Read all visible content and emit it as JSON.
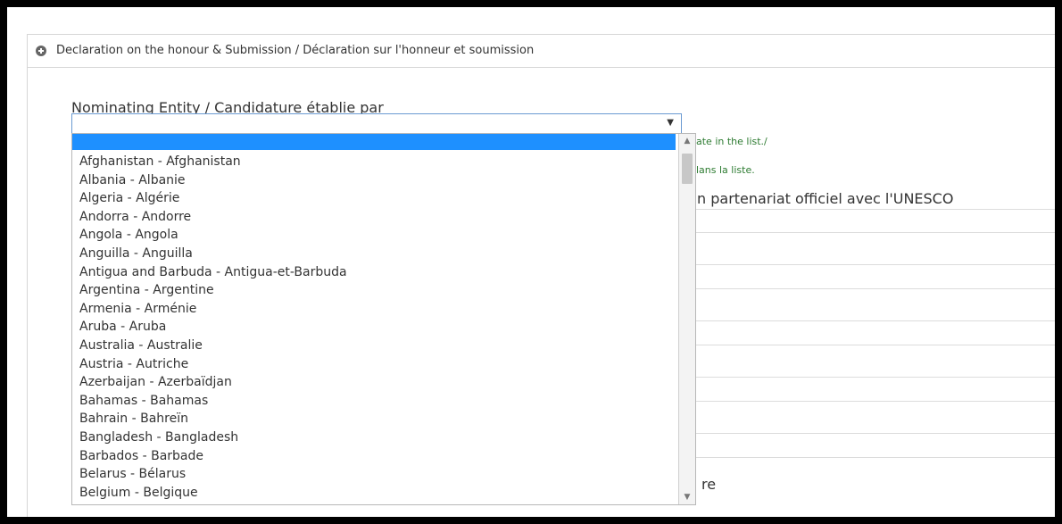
{
  "panel": {
    "title": "Declaration on the honour & Submission / Déclaration sur l'honneur et soumission",
    "icon": "plus-circle-icon"
  },
  "field": {
    "label": "Nominating Entity / Candidature établie par",
    "selected_value": "",
    "arrow": "▼"
  },
  "background": {
    "note_1": "ate in the list./",
    "note_2": "lans la liste.",
    "partnership_label": "n partenariat officiel avec l'UNESCO",
    "partial_label": "re"
  },
  "dropdown": {
    "options": [
      "Afghanistan - Afghanistan",
      "Albania - Albanie",
      "Algeria - Algérie",
      "Andorra - Andorre",
      "Angola - Angola",
      "Anguilla - Anguilla",
      "Antigua and Barbuda - Antigua-et-Barbuda",
      "Argentina - Argentine",
      "Armenia - Arménie",
      "Aruba - Aruba",
      "Australia - Australie",
      "Austria - Autriche",
      "Azerbaijan - Azerbaïdjan",
      "Bahamas - Bahamas",
      "Bahrain - Bahreïn",
      "Bangladesh - Bangladesh",
      "Barbados - Barbade",
      "Belarus - Bélarus",
      "Belgium - Belgique"
    ],
    "scroll_up": "▲",
    "scroll_down": "▼"
  },
  "colors": {
    "selected_highlight": "#1e90ff",
    "note_text": "#2d7b31",
    "select_border": "#6a9ad2"
  }
}
